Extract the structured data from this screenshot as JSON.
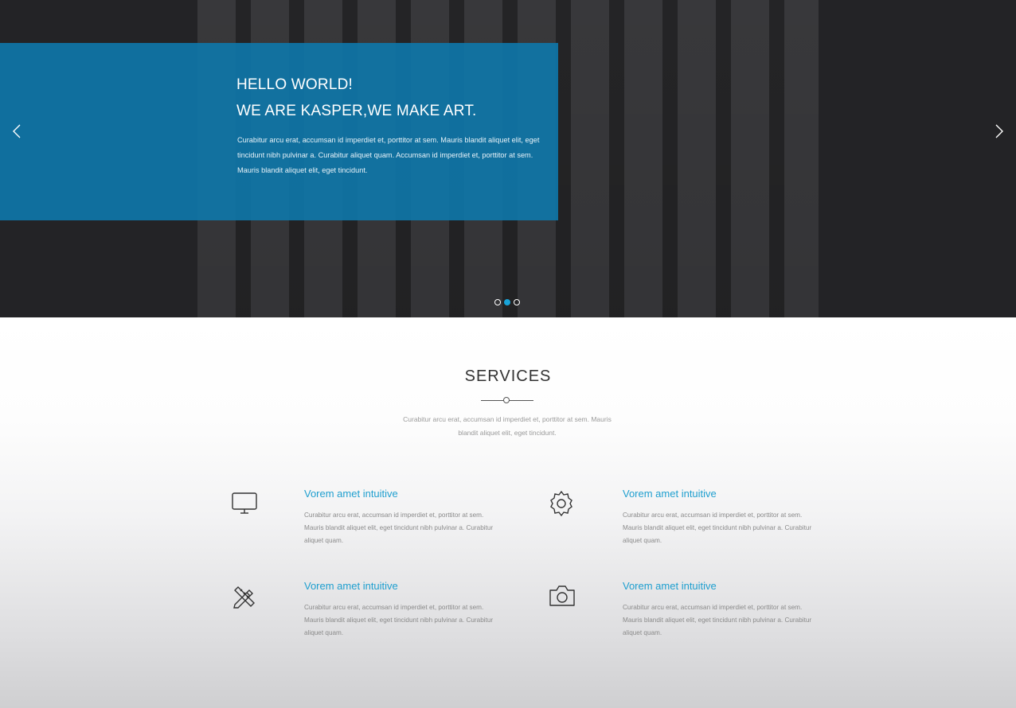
{
  "hero": {
    "line1": "HELLO WORLD!",
    "line2": "WE ARE KASPER,WE MAKE ART.",
    "paragraph": "Curabitur arcu erat, accumsan id imperdiet et, porttitor at sem. Mauris blandit aliquet elit, eget tincidunt nibh pulvinar a. Curabitur aliquet quam. Accumsan id imperdiet et, porttitor at sem. Mauris blandit aliquet elit, eget tincidunt.",
    "prev_icon": "chevron-left-icon",
    "next_icon": "chevron-right-icon",
    "slides": {
      "count": 3,
      "active_index": 1
    },
    "colors": {
      "overlay": "#0f76a8",
      "active_dot": "#19a3d8",
      "background": "#232326"
    }
  },
  "services": {
    "title": "SERVICES",
    "description": "Curabitur arcu erat, accumsan id imperdiet et, porttitor at sem. Mauris blandit aliquet elit, eget tincidunt.",
    "items": [
      {
        "icon": "monitor-icon",
        "title": "Vorem amet intuitive",
        "text": "Curabitur arcu erat, accumsan id imperdiet et, porttitor at sem. Mauris blandit aliquet elit, eget tincidunt nibh pulvinar a. Curabitur aliquet quam."
      },
      {
        "icon": "gear-icon",
        "title": "Vorem amet intuitive",
        "text": "Curabitur arcu erat, accumsan id imperdiet et, porttitor at sem. Mauris blandit aliquet elit, eget tincidunt nibh pulvinar a. Curabitur aliquet quam."
      },
      {
        "icon": "pencil-ruler-icon",
        "title": "Vorem amet intuitive",
        "text": "Curabitur arcu erat, accumsan id imperdiet et, porttitor at sem. Mauris blandit aliquet elit, eget tincidunt nibh pulvinar a. Curabitur aliquet quam."
      },
      {
        "icon": "camera-icon",
        "title": "Vorem amet intuitive",
        "text": "Curabitur arcu erat, accumsan id imperdiet et, porttitor at sem. Mauris blandit aliquet elit, eget tincidunt nibh pulvinar a. Curabitur aliquet quam."
      }
    ],
    "colors": {
      "item_title": "#1f9fcf",
      "heading": "#333333"
    }
  }
}
